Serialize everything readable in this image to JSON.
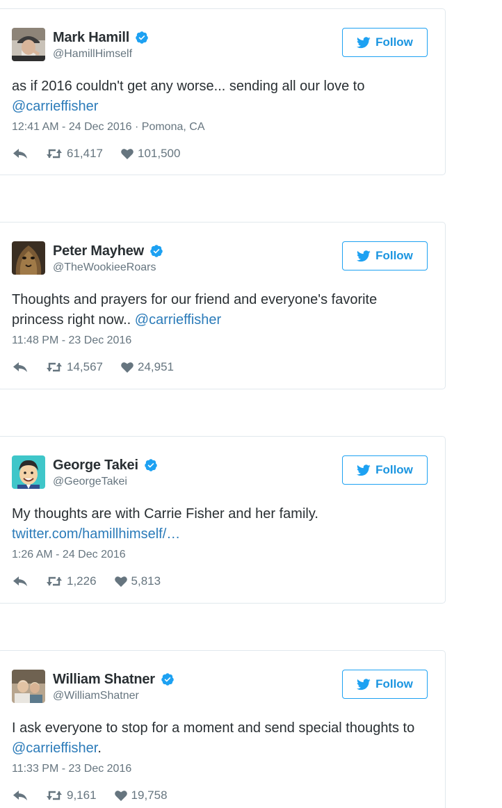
{
  "follow_label": "Follow",
  "tweets": [
    {
      "name": "Mark Hamill",
      "handle": "@HamillHimself",
      "text_before": "as if 2016 couldn't get any worse... sending all our love to",
      "link": "@carrieffisher",
      "text_after": "",
      "meta": "12:41 AM - 24 Dec 2016 · Pomona, CA",
      "retweets": "61,417",
      "likes": "101,500"
    },
    {
      "name": "Peter Mayhew",
      "handle": "@TheWookieeRoars",
      "text_before": "Thoughts and prayers for our friend and everyone's favorite princess right now..",
      "link": "@carrieffisher",
      "text_after": "",
      "meta": "11:48 PM - 23 Dec 2016",
      "retweets": "14,567",
      "likes": "24,951"
    },
    {
      "name": "George Takei",
      "handle": "@GeorgeTakei",
      "text_before": "My thoughts are with Carrie Fisher and her family.",
      "link": "twitter.com/hamillhimself/…",
      "text_after": "",
      "meta": "1:26 AM - 24 Dec 2016",
      "retweets": "1,226",
      "likes": "5,813"
    },
    {
      "name": "William Shatner",
      "handle": "@WilliamShatner",
      "text_before": "I ask everyone to stop for a moment and send special thoughts to",
      "link": "@carrieffisher",
      "text_after": ".",
      "meta": "11:33 PM - 23 Dec 2016",
      "retweets": "9,161",
      "likes": "19,758"
    }
  ],
  "colors": {
    "accent": "#1da1f2",
    "link": "#2b7bb9",
    "muted": "#66757f",
    "border": "#e1e8ed"
  },
  "icons": [
    "avatar",
    "verified-badge-icon",
    "twitter-bird-icon",
    "reply-icon",
    "retweet-icon",
    "heart-icon"
  ]
}
